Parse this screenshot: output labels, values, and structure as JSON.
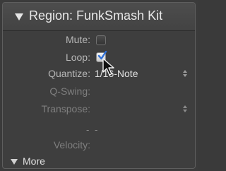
{
  "region": {
    "title": "Region: FunkSmash Kit"
  },
  "fields": {
    "mute_label": "Mute:",
    "loop_label": "Loop:",
    "quantize_label": "Quantize:",
    "quantize_value": "1/16-Note",
    "qswing_label": "Q-Swing:",
    "transpose_label": "Transpose:",
    "transpose_value": "- -",
    "velocity_label": "Velocity:"
  },
  "state": {
    "mute_checked": false,
    "loop_checked": true
  },
  "more": {
    "label": "More"
  },
  "icons": {
    "disclosure": "disclosure-triangle-icon",
    "check": "checkmark-icon",
    "stepper": "up-down-stepper-icon",
    "cursor": "mouse-pointer-icon"
  },
  "colors": {
    "panel_bg": "#3e3e3e",
    "check_blue": "#2f6fd6",
    "label_gray": "#b8b8b8",
    "value_white": "#e0e0e0"
  }
}
